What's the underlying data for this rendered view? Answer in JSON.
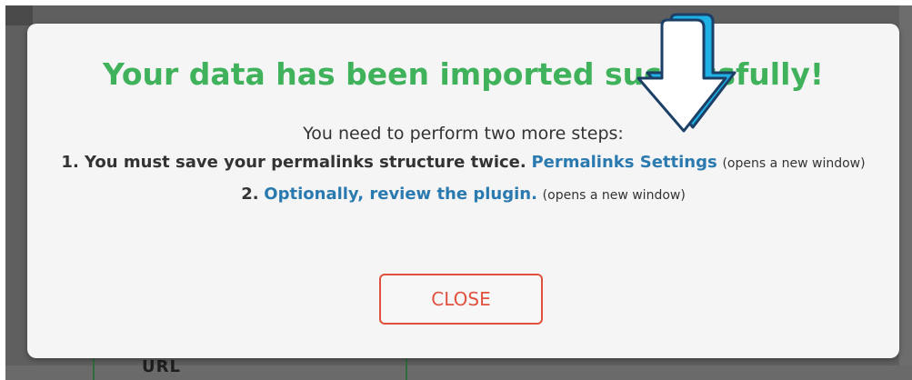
{
  "modal": {
    "title": "Your data has been imported successfully!",
    "intro": "You need to perform two more steps:",
    "step1": {
      "text": "1. You must save your permalinks structure twice.",
      "link_label": "Permalinks Settings",
      "note": "(opens a new window)"
    },
    "step2": {
      "prefix": "2.",
      "link_label": "Optionally, review the plugin.",
      "note": "(opens a new window)"
    },
    "close_label": "CLOSE"
  },
  "background": {
    "partial_label": "URL"
  },
  "icons": {
    "arrow": "arrow-down-icon"
  },
  "colors": {
    "title": "#3fb25b",
    "link": "#2a7ab0",
    "close": "#e0523f",
    "arrow_fill": "#ffffff",
    "arrow_outline": "#1c3f66",
    "arrow_shadow": "#1fb0e6"
  }
}
